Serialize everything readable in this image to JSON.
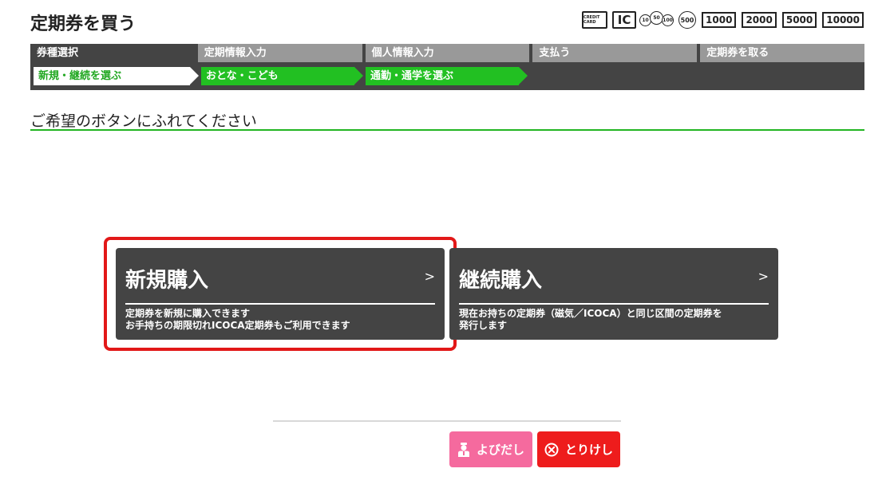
{
  "header": {
    "title": "定期券を買う",
    "payment": {
      "credit_card": "CREDIT CARD",
      "ic": "IC",
      "coins": [
        "10",
        "50",
        "100"
      ],
      "coin_500": "500",
      "bills": [
        "1000",
        "2000",
        "5000",
        "10000"
      ]
    }
  },
  "steps": {
    "items": [
      "券種選択",
      "定期情報入力",
      "個人情報入力",
      "支払う",
      "定期券を取る"
    ],
    "sub": [
      "新規・継続を選ぶ",
      "おとな・こども",
      "通勤・通学を選ぶ"
    ]
  },
  "instruction": "ご希望のボタンにふれてください",
  "options": {
    "new": {
      "title": "新規購入",
      "arrow": ">",
      "description": "定期券を新規に購入できます\nお手持ちの期限切れICOCA定期券もご利用できます"
    },
    "renew": {
      "title": "継続購入",
      "arrow": ">",
      "description": "現在お持ちの定期券（磁気／ICOCA）と同じ区間の定期券を\n発行します"
    }
  },
  "buttons": {
    "call": "よびだし",
    "cancel": "とりけし"
  },
  "colors": {
    "accent_green": "#22c022",
    "dark_panel": "#444444",
    "selection_red": "#e21818",
    "call_pink": "#f56a9e",
    "cancel_red": "#ee1c1c"
  }
}
